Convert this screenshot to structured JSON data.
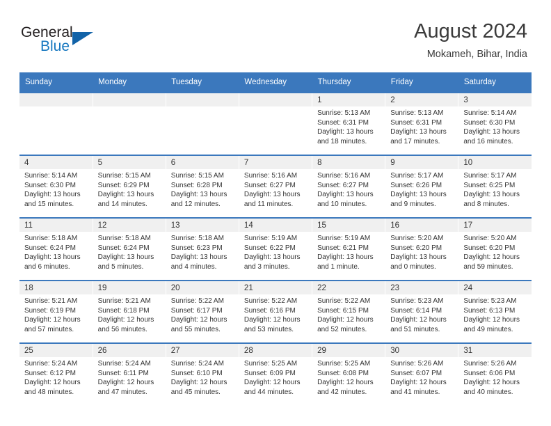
{
  "brand": {
    "name_top": "General",
    "name_bottom": "Blue",
    "triangle_color": "#1263a8",
    "blue_color": "#1878c0"
  },
  "header": {
    "title": "August 2024",
    "subtitle": "Mokameh, Bihar, India",
    "accent_color": "#3b78bd"
  },
  "calendar": {
    "weekday_headers": [
      "Sunday",
      "Monday",
      "Tuesday",
      "Wednesday",
      "Thursday",
      "Friday",
      "Saturday"
    ],
    "labels": {
      "sunrise": "Sunrise:",
      "sunset": "Sunset:",
      "daylight": "Daylight:"
    },
    "weeks": [
      [
        {
          "day": "",
          "sunrise": "",
          "sunset": "",
          "daylight_line1": "",
          "daylight_line2": ""
        },
        {
          "day": "",
          "sunrise": "",
          "sunset": "",
          "daylight_line1": "",
          "daylight_line2": ""
        },
        {
          "day": "",
          "sunrise": "",
          "sunset": "",
          "daylight_line1": "",
          "daylight_line2": ""
        },
        {
          "day": "",
          "sunrise": "",
          "sunset": "",
          "daylight_line1": "",
          "daylight_line2": ""
        },
        {
          "day": "1",
          "sunrise": "Sunrise: 5:13 AM",
          "sunset": "Sunset: 6:31 PM",
          "daylight_line1": "Daylight: 13 hours",
          "daylight_line2": "and 18 minutes."
        },
        {
          "day": "2",
          "sunrise": "Sunrise: 5:13 AM",
          "sunset": "Sunset: 6:31 PM",
          "daylight_line1": "Daylight: 13 hours",
          "daylight_line2": "and 17 minutes."
        },
        {
          "day": "3",
          "sunrise": "Sunrise: 5:14 AM",
          "sunset": "Sunset: 6:30 PM",
          "daylight_line1": "Daylight: 13 hours",
          "daylight_line2": "and 16 minutes."
        }
      ],
      [
        {
          "day": "4",
          "sunrise": "Sunrise: 5:14 AM",
          "sunset": "Sunset: 6:30 PM",
          "daylight_line1": "Daylight: 13 hours",
          "daylight_line2": "and 15 minutes."
        },
        {
          "day": "5",
          "sunrise": "Sunrise: 5:15 AM",
          "sunset": "Sunset: 6:29 PM",
          "daylight_line1": "Daylight: 13 hours",
          "daylight_line2": "and 14 minutes."
        },
        {
          "day": "6",
          "sunrise": "Sunrise: 5:15 AM",
          "sunset": "Sunset: 6:28 PM",
          "daylight_line1": "Daylight: 13 hours",
          "daylight_line2": "and 12 minutes."
        },
        {
          "day": "7",
          "sunrise": "Sunrise: 5:16 AM",
          "sunset": "Sunset: 6:27 PM",
          "daylight_line1": "Daylight: 13 hours",
          "daylight_line2": "and 11 minutes."
        },
        {
          "day": "8",
          "sunrise": "Sunrise: 5:16 AM",
          "sunset": "Sunset: 6:27 PM",
          "daylight_line1": "Daylight: 13 hours",
          "daylight_line2": "and 10 minutes."
        },
        {
          "day": "9",
          "sunrise": "Sunrise: 5:17 AM",
          "sunset": "Sunset: 6:26 PM",
          "daylight_line1": "Daylight: 13 hours",
          "daylight_line2": "and 9 minutes."
        },
        {
          "day": "10",
          "sunrise": "Sunrise: 5:17 AM",
          "sunset": "Sunset: 6:25 PM",
          "daylight_line1": "Daylight: 13 hours",
          "daylight_line2": "and 8 minutes."
        }
      ],
      [
        {
          "day": "11",
          "sunrise": "Sunrise: 5:18 AM",
          "sunset": "Sunset: 6:24 PM",
          "daylight_line1": "Daylight: 13 hours",
          "daylight_line2": "and 6 minutes."
        },
        {
          "day": "12",
          "sunrise": "Sunrise: 5:18 AM",
          "sunset": "Sunset: 6:24 PM",
          "daylight_line1": "Daylight: 13 hours",
          "daylight_line2": "and 5 minutes."
        },
        {
          "day": "13",
          "sunrise": "Sunrise: 5:18 AM",
          "sunset": "Sunset: 6:23 PM",
          "daylight_line1": "Daylight: 13 hours",
          "daylight_line2": "and 4 minutes."
        },
        {
          "day": "14",
          "sunrise": "Sunrise: 5:19 AM",
          "sunset": "Sunset: 6:22 PM",
          "daylight_line1": "Daylight: 13 hours",
          "daylight_line2": "and 3 minutes."
        },
        {
          "day": "15",
          "sunrise": "Sunrise: 5:19 AM",
          "sunset": "Sunset: 6:21 PM",
          "daylight_line1": "Daylight: 13 hours",
          "daylight_line2": "and 1 minute."
        },
        {
          "day": "16",
          "sunrise": "Sunrise: 5:20 AM",
          "sunset": "Sunset: 6:20 PM",
          "daylight_line1": "Daylight: 13 hours",
          "daylight_line2": "and 0 minutes."
        },
        {
          "day": "17",
          "sunrise": "Sunrise: 5:20 AM",
          "sunset": "Sunset: 6:20 PM",
          "daylight_line1": "Daylight: 12 hours",
          "daylight_line2": "and 59 minutes."
        }
      ],
      [
        {
          "day": "18",
          "sunrise": "Sunrise: 5:21 AM",
          "sunset": "Sunset: 6:19 PM",
          "daylight_line1": "Daylight: 12 hours",
          "daylight_line2": "and 57 minutes."
        },
        {
          "day": "19",
          "sunrise": "Sunrise: 5:21 AM",
          "sunset": "Sunset: 6:18 PM",
          "daylight_line1": "Daylight: 12 hours",
          "daylight_line2": "and 56 minutes."
        },
        {
          "day": "20",
          "sunrise": "Sunrise: 5:22 AM",
          "sunset": "Sunset: 6:17 PM",
          "daylight_line1": "Daylight: 12 hours",
          "daylight_line2": "and 55 minutes."
        },
        {
          "day": "21",
          "sunrise": "Sunrise: 5:22 AM",
          "sunset": "Sunset: 6:16 PM",
          "daylight_line1": "Daylight: 12 hours",
          "daylight_line2": "and 53 minutes."
        },
        {
          "day": "22",
          "sunrise": "Sunrise: 5:22 AM",
          "sunset": "Sunset: 6:15 PM",
          "daylight_line1": "Daylight: 12 hours",
          "daylight_line2": "and 52 minutes."
        },
        {
          "day": "23",
          "sunrise": "Sunrise: 5:23 AM",
          "sunset": "Sunset: 6:14 PM",
          "daylight_line1": "Daylight: 12 hours",
          "daylight_line2": "and 51 minutes."
        },
        {
          "day": "24",
          "sunrise": "Sunrise: 5:23 AM",
          "sunset": "Sunset: 6:13 PM",
          "daylight_line1": "Daylight: 12 hours",
          "daylight_line2": "and 49 minutes."
        }
      ],
      [
        {
          "day": "25",
          "sunrise": "Sunrise: 5:24 AM",
          "sunset": "Sunset: 6:12 PM",
          "daylight_line1": "Daylight: 12 hours",
          "daylight_line2": "and 48 minutes."
        },
        {
          "day": "26",
          "sunrise": "Sunrise: 5:24 AM",
          "sunset": "Sunset: 6:11 PM",
          "daylight_line1": "Daylight: 12 hours",
          "daylight_line2": "and 47 minutes."
        },
        {
          "day": "27",
          "sunrise": "Sunrise: 5:24 AM",
          "sunset": "Sunset: 6:10 PM",
          "daylight_line1": "Daylight: 12 hours",
          "daylight_line2": "and 45 minutes."
        },
        {
          "day": "28",
          "sunrise": "Sunrise: 5:25 AM",
          "sunset": "Sunset: 6:09 PM",
          "daylight_line1": "Daylight: 12 hours",
          "daylight_line2": "and 44 minutes."
        },
        {
          "day": "29",
          "sunrise": "Sunrise: 5:25 AM",
          "sunset": "Sunset: 6:08 PM",
          "daylight_line1": "Daylight: 12 hours",
          "daylight_line2": "and 42 minutes."
        },
        {
          "day": "30",
          "sunrise": "Sunrise: 5:26 AM",
          "sunset": "Sunset: 6:07 PM",
          "daylight_line1": "Daylight: 12 hours",
          "daylight_line2": "and 41 minutes."
        },
        {
          "day": "31",
          "sunrise": "Sunrise: 5:26 AM",
          "sunset": "Sunset: 6:06 PM",
          "daylight_line1": "Daylight: 12 hours",
          "daylight_line2": "and 40 minutes."
        }
      ]
    ]
  }
}
